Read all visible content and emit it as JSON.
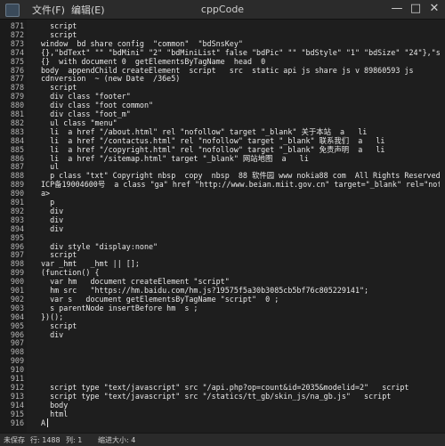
{
  "window": {
    "title": "cppCode",
    "menu": [
      "文件(F)",
      "编辑(E)"
    ],
    "minimize": "—",
    "maximize": "□",
    "close": "✕"
  },
  "editor": {
    "lines": [
      {
        "n": "871",
        "t": "  script"
      },
      {
        "n": "872",
        "t": "  script"
      },
      {
        "n": "873",
        "t": "window  bd share config  \"common\"  \"bdSnsKey\""
      },
      {
        "n": "874",
        "t": "{},\"bdText\" \"\" \"bdMini\" \"2\" \"bdMiniList\" false \"bdPic\" \"\" \"bdStyle\" \"1\" \"bdSize\" \"24\"},\"share\""
      },
      {
        "n": "875",
        "t": "{}  with document 0  getElementsByTagName  head  0 "
      },
      {
        "n": "876",
        "t": "body  appendChild createElement  script   src  static api js share js v 89860593 js"
      },
      {
        "n": "877",
        "t": "cdnversion  ~ (new Date  /36e5)"
      },
      {
        "n": "878",
        "t": "  script"
      },
      {
        "n": "879",
        "t": "  div class \"footer\""
      },
      {
        "n": "880",
        "t": "  div class \"foot common\""
      },
      {
        "n": "881",
        "t": "  div class \"foot_m\""
      },
      {
        "n": "882",
        "t": "  ul class \"menu\""
      },
      {
        "n": "883",
        "t": "  li  a href \"/about.html\" rel \"nofollow\" target \"_blank\" 关于本站  a   li"
      },
      {
        "n": "884",
        "t": "  li  a href \"/contactus.html\" rel \"nofollow\" target \"_blank\" 联系我们  a   li"
      },
      {
        "n": "885",
        "t": "  li  a href \"/copyright.html\" rel \"nofollow\" target \"_blank\" 免责声明  a   li"
      },
      {
        "n": "886",
        "t": "  li  a href \"/sitemap.html\" target \"_blank\" 网站地图  a   li"
      },
      {
        "n": "887",
        "t": "  ul"
      },
      {
        "n": "888",
        "t": "  p class \"txt\" Copyright nbsp  copy  nbsp  88 软件园 www nokia88 com  All Rights Reserved br 备案号:闽"
      },
      {
        "n": "889",
        "t": "ICP备19004600号  a class \"ga\" href \"http://www.beian.miit.gov.cn\" target=\"_blank\" rel=\"nofollow\"></"
      },
      {
        "n": "890",
        "t": "a>"
      },
      {
        "n": "891",
        "t": "  p"
      },
      {
        "n": "892",
        "t": "  div"
      },
      {
        "n": "893",
        "t": "  div"
      },
      {
        "n": "894",
        "t": "  div"
      },
      {
        "n": "895",
        "t": ""
      },
      {
        "n": "896",
        "t": "  div style \"display:none\""
      },
      {
        "n": "897",
        "t": "  script"
      },
      {
        "n": "898",
        "t": "var _hmt   _hmt || [];"
      },
      {
        "n": "899",
        "t": "(function() {"
      },
      {
        "n": "900",
        "t": "  var hm   document createElement \"script\""
      },
      {
        "n": "901",
        "t": "  hm src   \"https://hm.baidu.com/hm.js?19575f5a30b3085cb5bf76c805229141\";"
      },
      {
        "n": "902",
        "t": "  var s   document getElementsByTagName \"script\"  0 ;"
      },
      {
        "n": "903",
        "t": "  s parentNode insertBefore hm  s ;"
      },
      {
        "n": "904",
        "t": "})();"
      },
      {
        "n": "905",
        "t": "  script"
      },
      {
        "n": "906",
        "t": "  div"
      },
      {
        "n": "907",
        "t": ""
      },
      {
        "n": "908",
        "t": ""
      },
      {
        "n": "909",
        "t": ""
      },
      {
        "n": "910",
        "t": ""
      },
      {
        "n": "911",
        "t": ""
      },
      {
        "n": "912",
        "t": "  script type \"text/javascript\" src \"/api.php?op=count&id=2035&modelid=2\"   script"
      },
      {
        "n": "913",
        "t": "  script type \"text/javascript\" src \"/statics/tt_gb/skin_js/na_gb.js\"   script"
      },
      {
        "n": "914",
        "t": "  body"
      },
      {
        "n": "915",
        "t": "  html"
      },
      {
        "n": "916",
        "t": "A"
      }
    ]
  },
  "status": {
    "encoding": "未保存",
    "line": "行: 1488",
    "col": "列: 1",
    "indent": "缩进大小: 4"
  }
}
